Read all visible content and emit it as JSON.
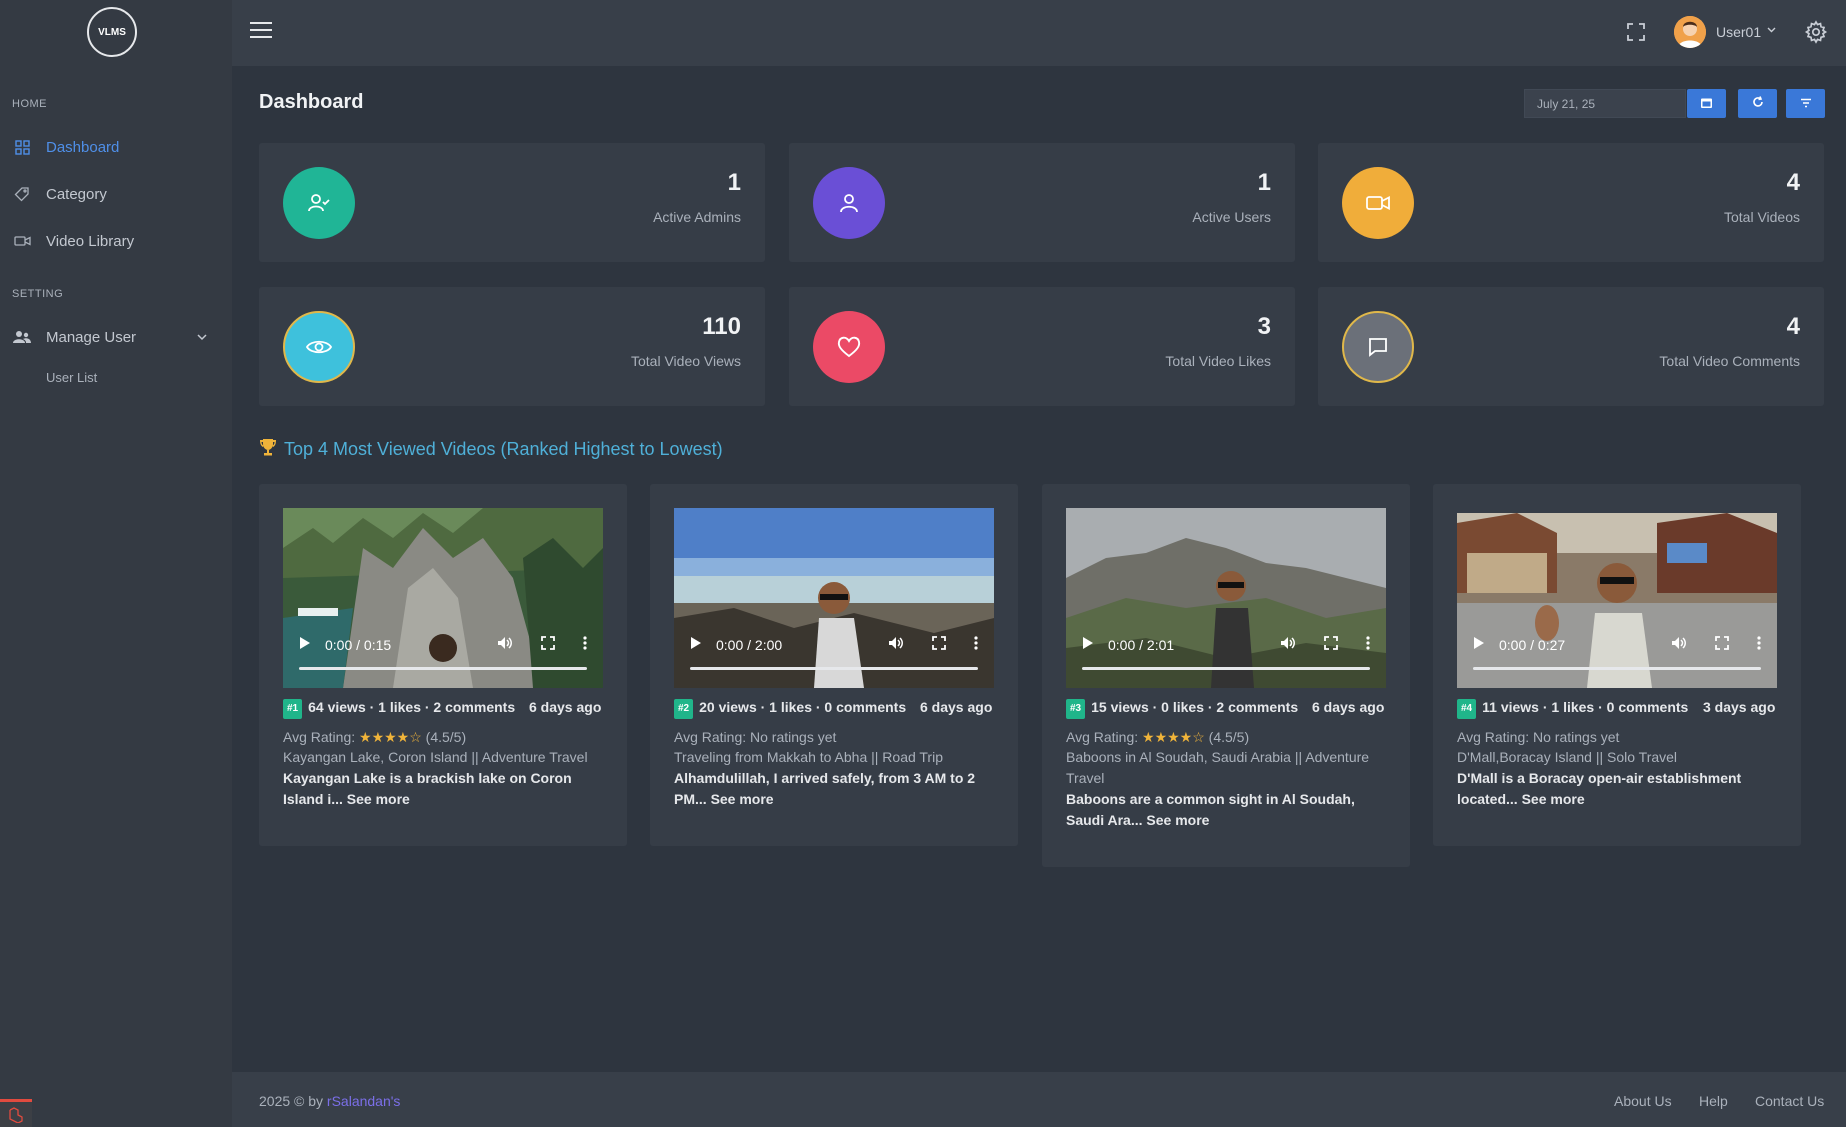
{
  "sidebar": {
    "logo_text": "VLMS",
    "section_home": "HOME",
    "items": [
      {
        "label": "Dashboard",
        "icon": "grid-icon",
        "active": true
      },
      {
        "label": "Category",
        "icon": "tag-icon"
      },
      {
        "label": "Video Library",
        "icon": "video-icon"
      }
    ],
    "section_setting": "SETTING",
    "manage_user": "Manage User",
    "user_list": "User List"
  },
  "topbar": {
    "user_name": "User01"
  },
  "page": {
    "title": "Dashboard",
    "date_value": "July 21, 25"
  },
  "stats": [
    {
      "value": "1",
      "label": "Active Admins",
      "color": "#20b596",
      "icon": "user-check-icon"
    },
    {
      "value": "1",
      "label": "Active Users",
      "color": "#6a4fd6",
      "icon": "user-icon"
    },
    {
      "value": "4",
      "label": "Total Videos",
      "color": "#f0ad3a",
      "icon": "video-camera-icon"
    },
    {
      "value": "110",
      "label": "Total Video Views",
      "color": "#3ec1dc",
      "icon": "eye-icon"
    },
    {
      "value": "3",
      "label": "Total Video Likes",
      "color": "#eb4a66",
      "icon": "heart-icon"
    },
    {
      "value": "4",
      "label": "Total Video Comments",
      "color": "#6b7079",
      "icon": "comment-icon"
    }
  ],
  "top_videos": {
    "heading": "Top 4 Most Viewed Videos (Ranked Highest to Lowest)",
    "videos": [
      {
        "rank": "#1",
        "time": "0:00 / 0:15",
        "stats": "64 views · 1 likes · 2 comments",
        "ago": "6 days ago",
        "rating_label": "Avg Rating:",
        "stars": "★★★★☆",
        "rating": "(4.5/5)",
        "title": "Kayangan Lake, Coron Island || Adventure Travel",
        "desc": "Kayangan Lake is a brackish lake on Coron Island i...",
        "see_more": "See more"
      },
      {
        "rank": "#2",
        "time": "0:00 / 2:00",
        "stats": "20 views · 1 likes · 0 comments",
        "ago": "6 days ago",
        "rating_label": "Avg Rating:",
        "stars": "",
        "rating": "No ratings yet",
        "title": "Traveling from Makkah to Abha || Road Trip",
        "desc": "Alhamdulillah, I arrived safely, from 3 AM to 2 PM...",
        "see_more": "See more"
      },
      {
        "rank": "#3",
        "time": "0:00 / 2:01",
        "stats": "15 views · 0 likes · 2 comments",
        "ago": "6 days ago",
        "rating_label": "Avg Rating:",
        "stars": "★★★★☆",
        "rating": "(4.5/5)",
        "title": "Baboons in Al Soudah, Saudi Arabia || Adventure Travel",
        "desc": "Baboons are a common sight in Al Soudah, Saudi Ara...",
        "see_more": "See more"
      },
      {
        "rank": "#4",
        "time": "0:00 / 0:27",
        "stats": "11 views · 1 likes · 0 comments",
        "ago": "3 days ago",
        "rating_label": "Avg Rating:",
        "stars": "",
        "rating": "No ratings yet",
        "title": "D'Mall,Boracay Island || Solo Travel",
        "desc": "D'Mall is a Boracay open-air establishment located...",
        "see_more": "See more"
      }
    ]
  },
  "footer": {
    "copyright": "2025 © by",
    "author": "rSalandan's",
    "links": [
      "About Us",
      "Help",
      "Contact Us"
    ]
  },
  "colors": {
    "accent": "#3a78d8",
    "rank_badge": "#20b58a",
    "heading": "#4fb0d8"
  }
}
